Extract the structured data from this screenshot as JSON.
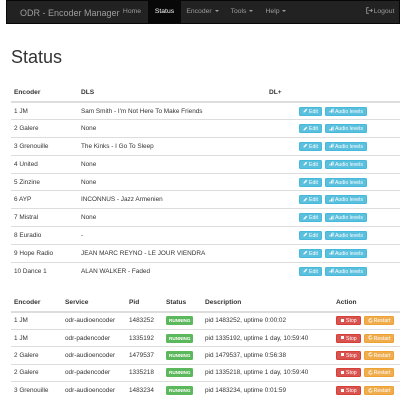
{
  "navbar": {
    "brand": "ODR - Encoder Manager",
    "items": [
      {
        "label": "Home"
      },
      {
        "label": "Status"
      },
      {
        "label": "Encoder"
      },
      {
        "label": "Tools"
      },
      {
        "label": "Help"
      }
    ],
    "logout": "Logout"
  },
  "page": {
    "title": "Status"
  },
  "colors": {
    "navbar_bg": "#222222",
    "info": "#5bc0de",
    "danger": "#d9534f",
    "warning": "#f0ad4e",
    "success": "#5cb85c"
  },
  "encoders_table": {
    "headers": [
      "Encoder",
      "DLS",
      "DL+"
    ],
    "edit_label": "Edit",
    "audio_label": "Audio levels",
    "rows": [
      {
        "encoder": "1 JM",
        "dls": "Sam Smith - I'm Not Here To Make Friends",
        "dlplus": ""
      },
      {
        "encoder": "2 Galere",
        "dls": "None",
        "dlplus": ""
      },
      {
        "encoder": "3 Grenouille",
        "dls": "The Kinks - I Go To Sleep",
        "dlplus": ""
      },
      {
        "encoder": "4 United",
        "dls": "None",
        "dlplus": ""
      },
      {
        "encoder": "5 Zinzine",
        "dls": "None",
        "dlplus": ""
      },
      {
        "encoder": "6 AYP",
        "dls": "INCONNUS - Jazz Armenien",
        "dlplus": ""
      },
      {
        "encoder": "7 Mistral",
        "dls": "None",
        "dlplus": ""
      },
      {
        "encoder": "8 Euradio",
        "dls": "-",
        "dlplus": ""
      },
      {
        "encoder": "9 Hope Radio",
        "dls": "JEAN MARC REYNO - LE JOUR VIENDRA",
        "dlplus": ""
      },
      {
        "encoder": "10 Dance 1",
        "dls": "ALAN WALKER - Faded",
        "dlplus": ""
      }
    ]
  },
  "services_table": {
    "headers": [
      "Encoder",
      "Service",
      "Pid",
      "Status",
      "Description",
      "Action"
    ],
    "stop_label": "Stop",
    "restart_label": "Restart",
    "rows": [
      {
        "encoder": "1 JM",
        "service": "odr-audioencoder",
        "pid": "1483252",
        "status": "RUNNING",
        "description": "pid 1483252, uptime 0:00:02"
      },
      {
        "encoder": "1 JM",
        "service": "odr-padencoder",
        "pid": "1335192",
        "status": "RUNNING",
        "description": "pid 1335192, uptime 1 day, 10:59:40"
      },
      {
        "encoder": "2 Galere",
        "service": "odr-audioencoder",
        "pid": "1479537",
        "status": "RUNNING",
        "description": "pid 1479537, uptime 0:56:38"
      },
      {
        "encoder": "2 Galere",
        "service": "odr-padencoder",
        "pid": "1335218",
        "status": "RUNNING",
        "description": "pid 1335218, uptime 1 day, 10:59:40"
      },
      {
        "encoder": "3 Grenouille",
        "service": "odr-audioencoder",
        "pid": "1483234",
        "status": "RUNNING",
        "description": "pid 1483234, uptime 0:01:59"
      }
    ]
  }
}
